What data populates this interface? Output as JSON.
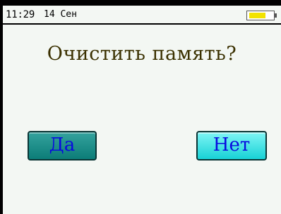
{
  "status_bar": {
    "time": "11:29",
    "date": "14 Сен",
    "battery_level": 0.72
  },
  "dialog": {
    "title": "Очистить память?",
    "yes_label": "Да",
    "no_label": "Нет"
  }
}
